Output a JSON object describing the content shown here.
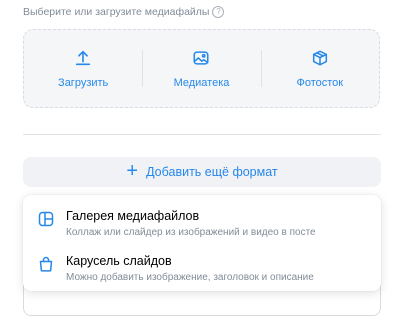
{
  "hint": {
    "text": "Выберите или загрузите медиафайлы",
    "help_glyph": "?"
  },
  "upload_options": [
    {
      "label": "Загрузить",
      "icon": "upload-icon"
    },
    {
      "label": "Медиатека",
      "icon": "image-icon"
    },
    {
      "label": "Фотосток",
      "icon": "box-icon"
    }
  ],
  "add_format": {
    "label": "Добавить ещё формат",
    "icon_glyph": "+"
  },
  "menu": {
    "items": [
      {
        "title": "Галерея медиафайлов",
        "subtitle": "Коллаж или слайдер из изображений и видео в посте",
        "icon": "gallery-icon"
      },
      {
        "title": "Карусель слайдов",
        "subtitle": "Можно добавить изображение, заголовок и описание",
        "icon": "bag-icon"
      }
    ]
  },
  "colors": {
    "accent": "#2688eb",
    "muted": "#818c99"
  }
}
